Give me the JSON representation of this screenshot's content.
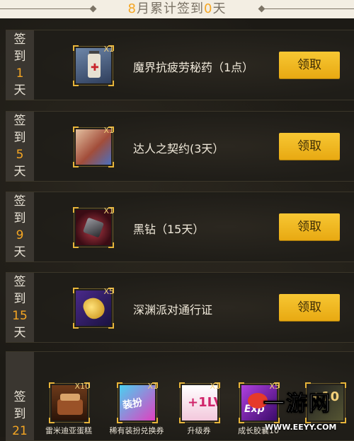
{
  "header": {
    "prefix_num": "8",
    "middle": "月累计签到",
    "count_num": "0",
    "suffix": "天"
  },
  "rows": [
    {
      "label_chars": [
        "签",
        "到"
      ],
      "day": "1",
      "suffix": "天",
      "item": {
        "name": "魔界抗疲劳秘药（1点）",
        "qty": "X1",
        "icon": "potion-icon"
      },
      "button": "领取"
    },
    {
      "label_chars": [
        "签",
        "到"
      ],
      "day": "5",
      "suffix": "天",
      "item": {
        "name": "达人之契约(3天）",
        "qty": "X1",
        "icon": "contract-icon"
      },
      "button": "领取"
    },
    {
      "label_chars": [
        "签",
        "到"
      ],
      "day": "9",
      "suffix": "天",
      "item": {
        "name": "黑钻（15天）",
        "qty": "X1",
        "icon": "black-diamond-icon"
      },
      "button": "领取"
    },
    {
      "label_chars": [
        "签",
        "到"
      ],
      "day": "15",
      "suffix": "天",
      "item": {
        "name": "深渊派对通行证",
        "qty": "X5",
        "icon": "abyss-pass-icon"
      },
      "button": "领取"
    }
  ],
  "row21": {
    "label_chars": [
      "签",
      "到"
    ],
    "day": "21",
    "items": [
      {
        "name": "雷米迪亚蛋糕",
        "qty": "X10",
        "icon": "cake-icon",
        "icon_text": ""
      },
      {
        "name": "稀有装扮兑换券",
        "qty": "X1",
        "icon": "coupon-icon",
        "icon_text": "装扮"
      },
      {
        "name": "升级券",
        "qty": "X1",
        "icon": "level-up-icon",
        "icon_text": "+1LV"
      },
      {
        "name": "成长胶囊10",
        "qty": "X5",
        "icon": "exp-capsule-icon",
        "icon_text": "Exp"
      },
      {
        "name": "",
        "qty": "",
        "icon": "enhance-icon",
        "icon_text": "+10"
      }
    ]
  },
  "watermark": {
    "title": "一游网",
    "url": "WWW.EEYY.COM"
  }
}
